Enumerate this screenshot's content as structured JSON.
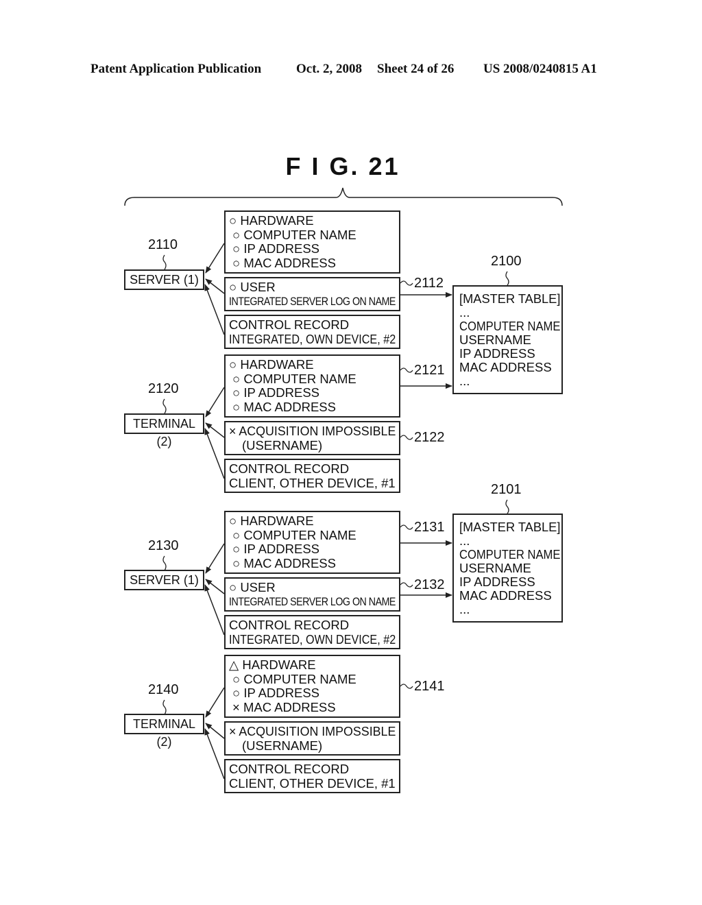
{
  "header": {
    "publication": "Patent Application Publication",
    "date": "Oct. 2, 2008",
    "sheet": "Sheet 24 of 26",
    "number": "US 2008/0240815 A1"
  },
  "figure": {
    "title": "F I G. 21"
  },
  "groups": [
    {
      "node": {
        "ref": "2110",
        "label": "SERVER (1)"
      },
      "boxes": [
        {
          "ref": "",
          "lines": [
            "○ HARDWARE",
            "○ COMPUTER NAME",
            "○ IP ADDRESS",
            "○ MAC ADDRESS"
          ]
        },
        {
          "ref": "2112",
          "lines": [
            "○ USER",
            "INTEGRATED SERVER LOG ON NAME"
          ]
        },
        {
          "ref": "",
          "lines": [
            "CONTROL RECORD",
            "INTEGRATED, OWN DEVICE, #2"
          ]
        }
      ]
    },
    {
      "node": {
        "ref": "2120",
        "label": "TERMINAL (2)"
      },
      "boxes": [
        {
          "ref": "2121",
          "lines": [
            "○ HARDWARE",
            "○ COMPUTER NAME",
            "○ IP ADDRESS",
            "○ MAC ADDRESS"
          ]
        },
        {
          "ref": "2122",
          "lines": [
            "× ACQUISITION IMPOSSIBLE",
            "(USERNAME)"
          ]
        },
        {
          "ref": "",
          "lines": [
            "CONTROL RECORD",
            "CLIENT, OTHER DEVICE, #1"
          ]
        }
      ]
    },
    {
      "node": {
        "ref": "2130",
        "label": "SERVER (1)"
      },
      "boxes": [
        {
          "ref": "2131",
          "lines": [
            "○ HARDWARE",
            "○ COMPUTER NAME",
            "○ IP ADDRESS",
            "○ MAC ADDRESS"
          ]
        },
        {
          "ref": "2132",
          "lines": [
            "○ USER",
            "INTEGRATED SERVER LOG ON NAME"
          ]
        },
        {
          "ref": "",
          "lines": [
            "CONTROL RECORD",
            "INTEGRATED, OWN DEVICE, #2"
          ]
        }
      ]
    },
    {
      "node": {
        "ref": "2140",
        "label": "TERMINAL (2)"
      },
      "boxes": [
        {
          "ref": "2141",
          "lines": [
            "△ HARDWARE",
            "○ COMPUTER NAME",
            "○ IP ADDRESS",
            "× MAC ADDRESS"
          ]
        },
        {
          "ref": "",
          "lines": [
            "× ACQUISITION IMPOSSIBLE",
            "(USERNAME)"
          ]
        },
        {
          "ref": "",
          "lines": [
            "CONTROL RECORD",
            "CLIENT, OTHER DEVICE, #1"
          ]
        }
      ]
    }
  ],
  "master_tables": [
    {
      "ref": "2100",
      "lines": [
        "[MASTER TABLE]",
        "...",
        "COMPUTER NAME",
        "USERNAME",
        "IP ADDRESS",
        "MAC ADDRESS",
        "..."
      ]
    },
    {
      "ref": "2101",
      "lines": [
        "[MASTER TABLE]",
        "...",
        "COMPUTER NAME",
        "USERNAME",
        "IP ADDRESS",
        "MAC ADDRESS",
        "..."
      ]
    }
  ]
}
